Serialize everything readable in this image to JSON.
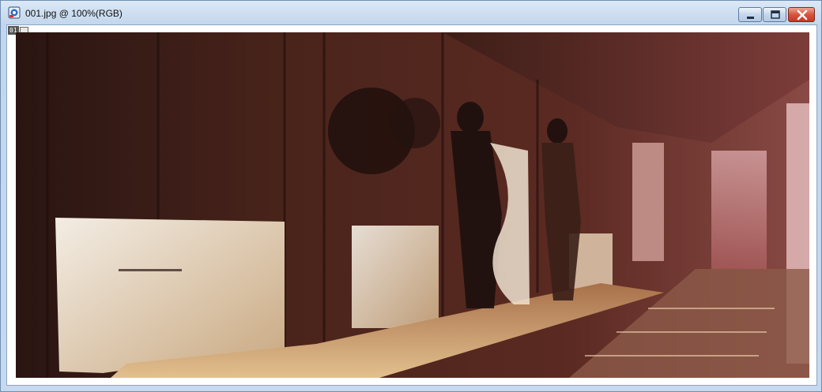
{
  "window": {
    "title": "001.jpg @ 100%(RGB)",
    "icon": "photoshop-document-icon"
  },
  "controls": {
    "minimize_icon": "minimize-icon",
    "maximize_icon": "maximize-icon",
    "close_icon": "close-icon"
  },
  "canvas": {
    "layer_badge": "01",
    "layer_badge_icon": "image-icon"
  },
  "colors": {
    "window_frame": "#c7d9ee",
    "close_button": "#c23a22",
    "canvas_background": "#ffffff"
  }
}
